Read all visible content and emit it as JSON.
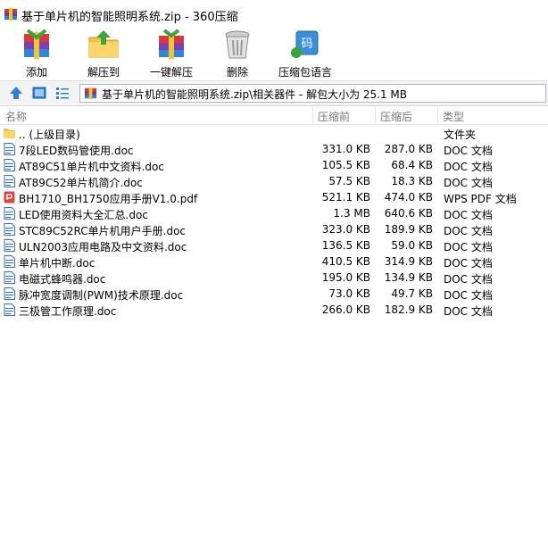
{
  "window": {
    "title": "基于单片机的智能照明系统.zip - 360压缩"
  },
  "toolbar": {
    "add": "添加",
    "extract_to": "解压到",
    "one_click_extract": "一键解压",
    "delete": "删除",
    "encoding": "压缩包语言"
  },
  "address": {
    "path": "基于单片机的智能照明系统.zip\\相关器件 - 解包大小为 25.1 MB"
  },
  "columns": {
    "name": "名称",
    "compressed": "压缩前",
    "original": "压缩后",
    "type": "类型"
  },
  "rows": [
    {
      "name": ".. (上级目录)",
      "compressed": "",
      "original": "",
      "type": "文件夹",
      "icon": "folder-icon"
    },
    {
      "name": "7段LED数码管使用.doc",
      "compressed": "331.0 KB",
      "original": "287.0 KB",
      "type": "DOC 文档",
      "icon": "doc-icon"
    },
    {
      "name": "AT89C51单片机中文资料.doc",
      "compressed": "105.5 KB",
      "original": "68.4 KB",
      "type": "DOC 文档",
      "icon": "doc-icon"
    },
    {
      "name": "AT89C52单片机简介.doc",
      "compressed": "57.5 KB",
      "original": "18.3 KB",
      "type": "DOC 文档",
      "icon": "doc-icon"
    },
    {
      "name": "BH1710_BH1750应用手册V1.0.pdf",
      "compressed": "521.1 KB",
      "original": "474.0 KB",
      "type": "WPS PDF 文档",
      "icon": "pdf-icon"
    },
    {
      "name": "LED使用资料大全汇总.doc",
      "compressed": "1.3 MB",
      "original": "640.6 KB",
      "type": "DOC 文档",
      "icon": "doc-icon"
    },
    {
      "name": "STC89C52RC单片机用户手册.doc",
      "compressed": "323.0 KB",
      "original": "189.9 KB",
      "type": "DOC 文档",
      "icon": "doc-icon"
    },
    {
      "name": "ULN2003应用电路及中文资料.doc",
      "compressed": "136.5 KB",
      "original": "59.0 KB",
      "type": "DOC 文档",
      "icon": "doc-icon"
    },
    {
      "name": "单片机中断.doc",
      "compressed": "410.5 KB",
      "original": "314.9 KB",
      "type": "DOC 文档",
      "icon": "doc-icon"
    },
    {
      "name": "电磁式蜂鸣器.doc",
      "compressed": "195.0 KB",
      "original": "134.9 KB",
      "type": "DOC 文档",
      "icon": "doc-icon"
    },
    {
      "name": "脉冲宽度调制(PWM)技术原理.doc",
      "compressed": "73.0 KB",
      "original": "49.7 KB",
      "type": "DOC 文档",
      "icon": "doc-icon"
    },
    {
      "name": "三极管工作原理.doc",
      "compressed": "266.0 KB",
      "original": "182.9 KB",
      "type": "DOC 文档",
      "icon": "doc-icon"
    }
  ]
}
